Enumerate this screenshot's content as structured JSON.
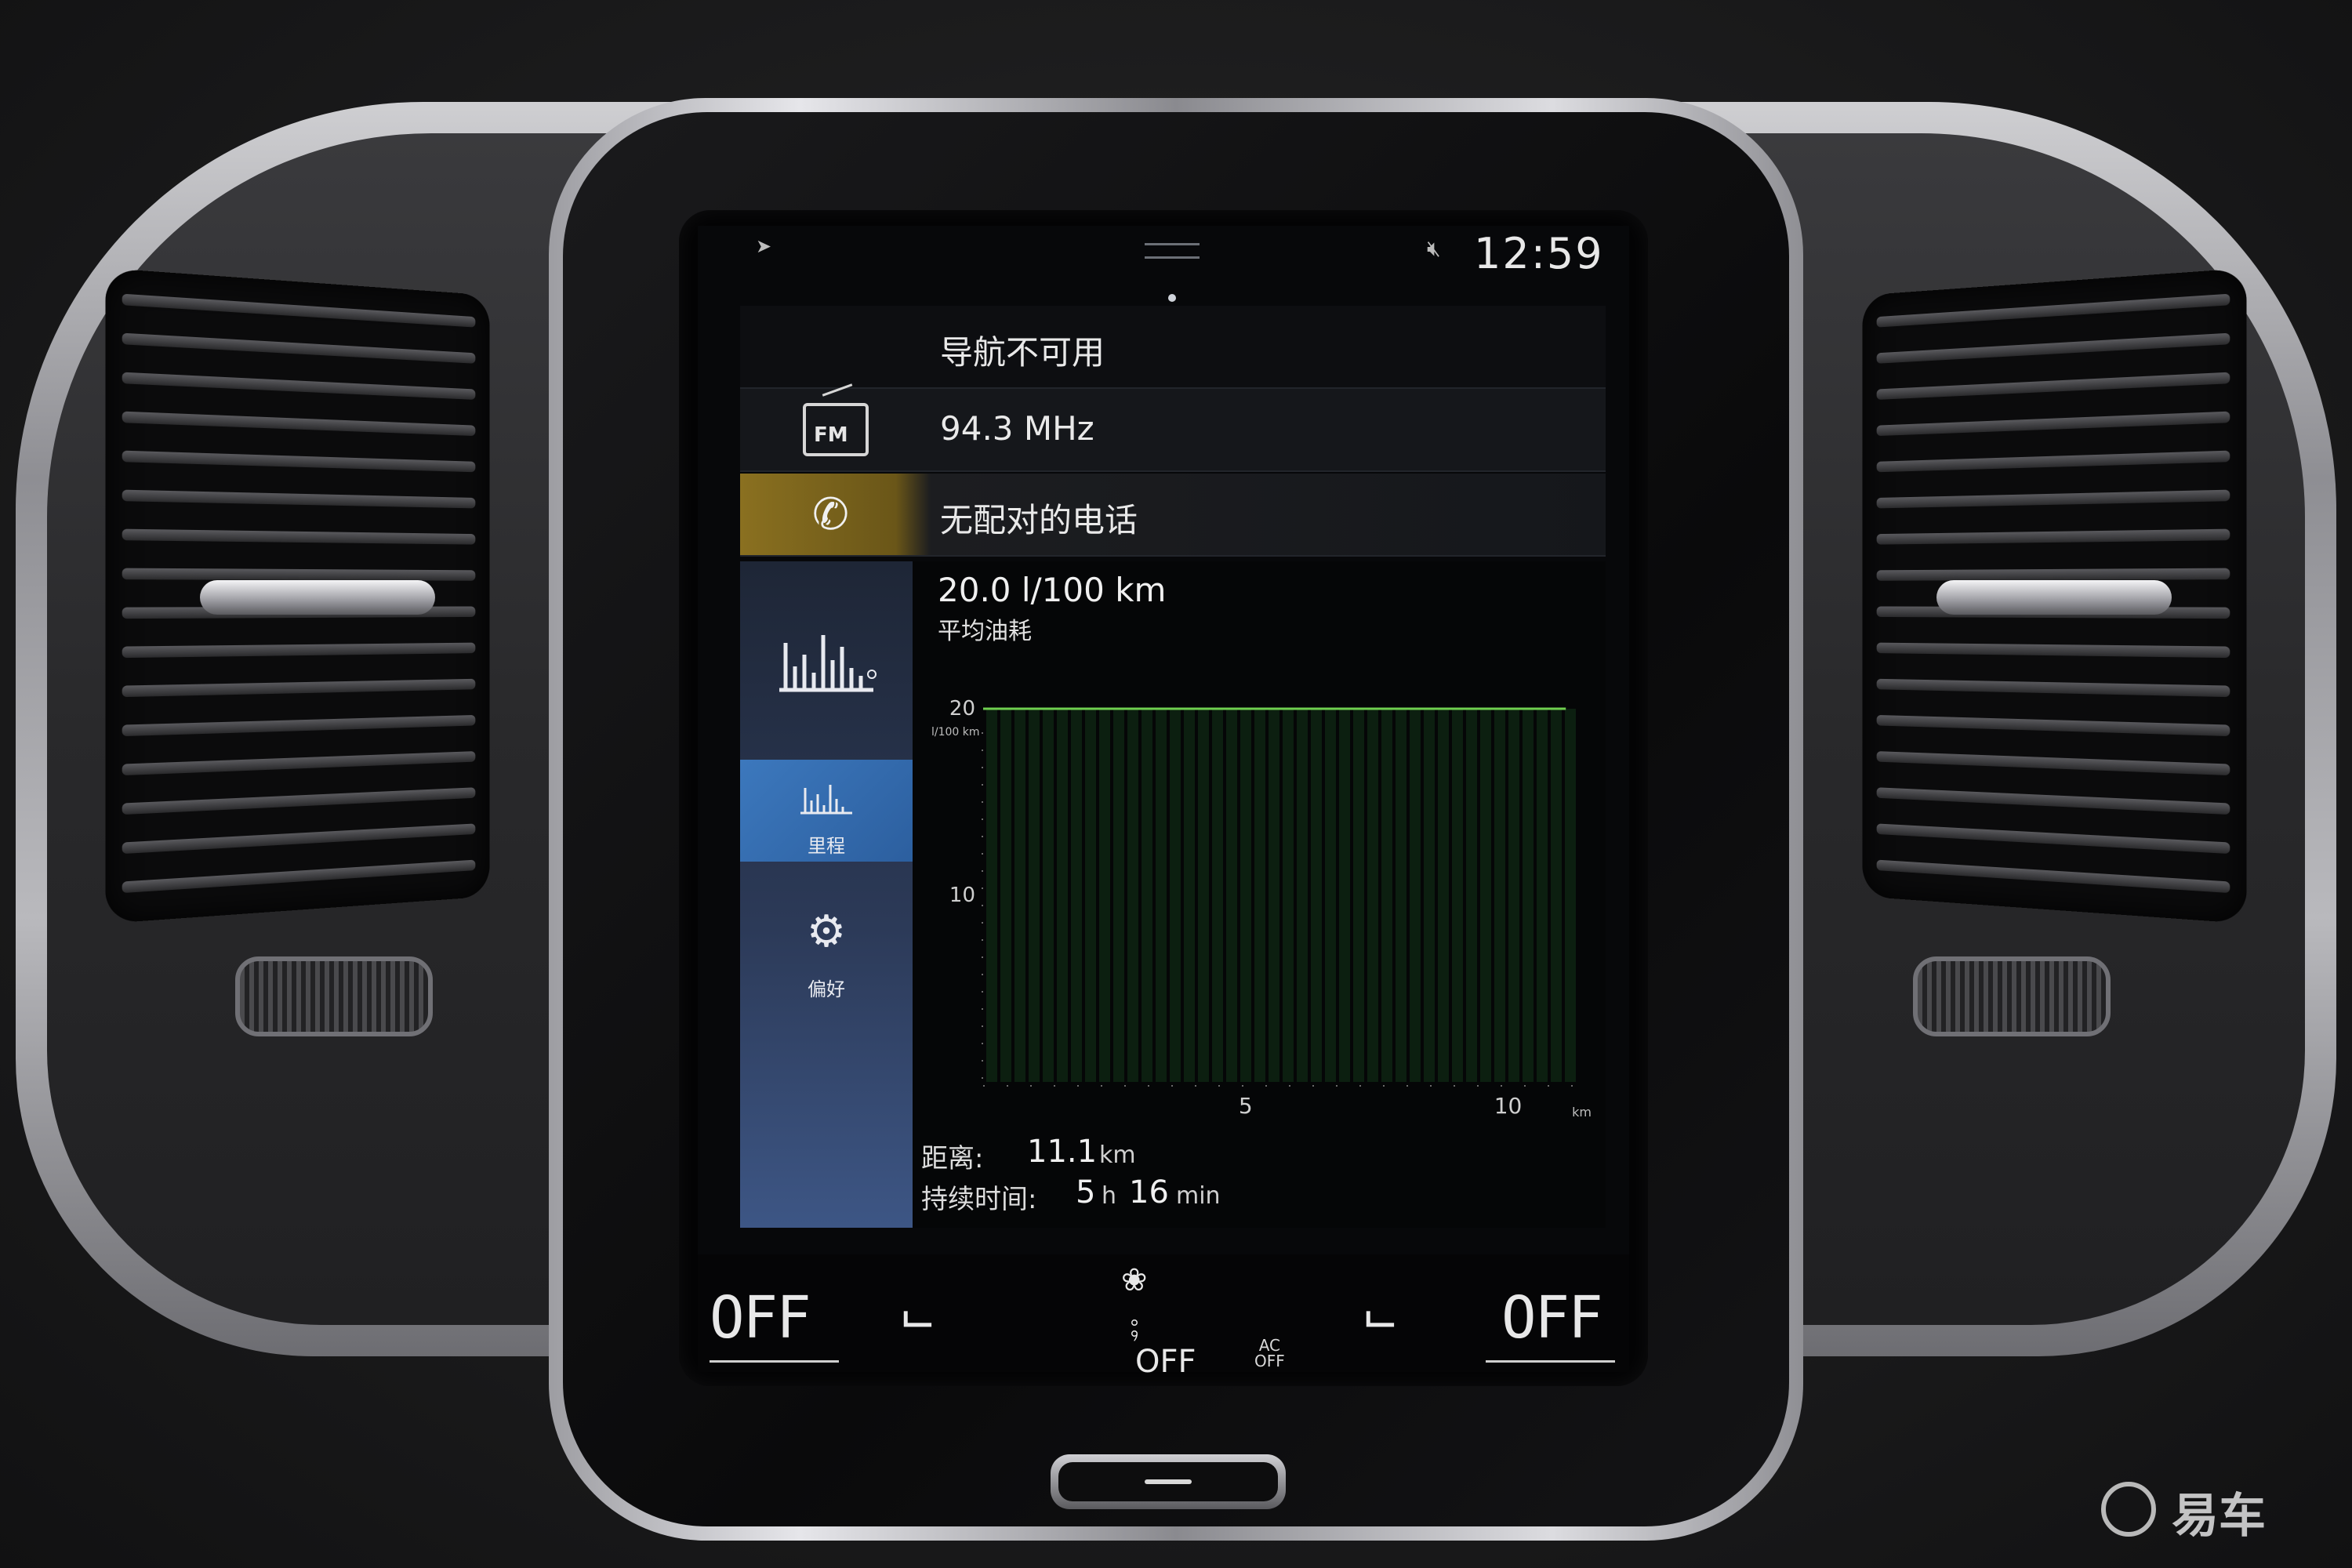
{
  "status": {
    "time": "12:59",
    "mute_icon": "speaker-muted-icon",
    "nav_icon": "navigation-arrow-icon"
  },
  "tiles": {
    "navigation": "导航不可用",
    "radio": {
      "badge": "FM",
      "frequency": "94.3 MHz"
    },
    "phone": {
      "label": "无配对的电话"
    }
  },
  "accent_colors": {
    "phone_tile": "#8a7020",
    "active_tab": "#3c78bd",
    "graph_line": "#6fcf4f"
  },
  "sidebar": {
    "items": [
      {
        "label": "",
        "icon": "average-consumption-bars-icon"
      },
      {
        "label": "里程",
        "icon": "trip-bars-icon",
        "active": true
      },
      {
        "label": "偏好",
        "icon": "gear-icon"
      }
    ]
  },
  "trip": {
    "average_value": "20.0 l/100 km",
    "average_label": "平均油耗",
    "distance_label": "距离:",
    "distance_value": "11.1",
    "distance_unit": "km",
    "duration_label": "持续时间:",
    "duration_hours": "5",
    "duration_hours_unit": "h",
    "duration_minutes": "16",
    "duration_minutes_unit": "min"
  },
  "chart_data": {
    "type": "line",
    "x": [
      0,
      11.1
    ],
    "series": [
      {
        "values": [
          20,
          20
        ]
      }
    ],
    "xlabel": "km",
    "ylabel": "l/100 km",
    "xticks": [
      "5",
      "10"
    ],
    "yticks": [
      "10",
      "20"
    ],
    "xlim": [
      0,
      11.5
    ],
    "ylim": [
      0,
      20
    ]
  },
  "climate": {
    "left_temp": "OFF",
    "right_temp": "OFF",
    "fan_status": "OFF",
    "ac_label": "AC",
    "ac_status": "OFF"
  },
  "watermark": "易车"
}
